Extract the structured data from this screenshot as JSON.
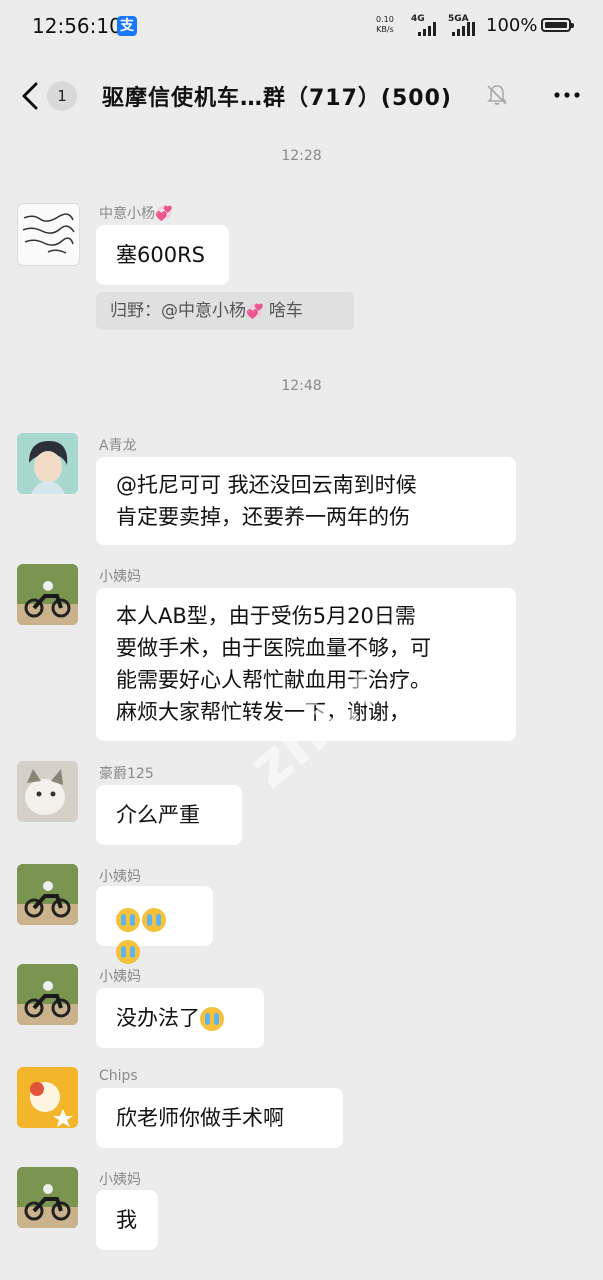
{
  "status_bar": {
    "time": "12:56:10",
    "app_indicator": "支",
    "speed_value": "0.10",
    "speed_unit": "KB/s",
    "net1": "4G",
    "net2": "5GA",
    "battery_pct": "100%",
    "battery_level": 1.0
  },
  "header": {
    "unread_count": "1",
    "title": "驱摩信使机车…群（717）(500)",
    "icons": [
      "back-chevron-icon",
      "mute-bell-icon",
      "more-dots-icon"
    ]
  },
  "watermark": "zhi.c",
  "messages": [
    {
      "type": "time",
      "text": "12:28"
    },
    {
      "type": "msg",
      "sender": "中意小杨",
      "sender_heart": "💞",
      "lines": [
        "塞600RS"
      ]
    },
    {
      "type": "quote",
      "prefix": "归野：@中意小杨",
      "heart": "💞",
      "suffix": " 啥车"
    },
    {
      "type": "time",
      "text": "12:48"
    },
    {
      "type": "msg",
      "sender": "A青龙",
      "lines": [
        "@托尼可可  我还没回云南到时候",
        "肯定要卖掉，还要养一两年的伤"
      ]
    },
    {
      "type": "msg",
      "sender": "小姨妈",
      "lines": [
        "本人AB型，由于受伤5月20日需",
        "要做手术，由于医院血量不够，可",
        "能需要好心人帮忙献血用于治疗。",
        "麻烦大家帮忙转发一下，谢谢，"
      ]
    },
    {
      "type": "msg",
      "sender": "豪爵125",
      "lines": [
        "介么严重"
      ]
    },
    {
      "type": "msg",
      "sender": "小姨妈",
      "emoji": [
        "loudly-crying-emoji",
        "loudly-crying-emoji",
        "loudly-crying-emoji"
      ]
    },
    {
      "type": "msg",
      "sender": "小姨妈",
      "lines": [
        "没办法了"
      ],
      "trailing_emoji": "loudly-crying-emoji"
    },
    {
      "type": "msg",
      "sender": "Chips",
      "lines": [
        "欣老师你做手术啊"
      ]
    },
    {
      "type": "msg",
      "sender": "小姨妈",
      "lines": [
        "我"
      ]
    }
  ]
}
